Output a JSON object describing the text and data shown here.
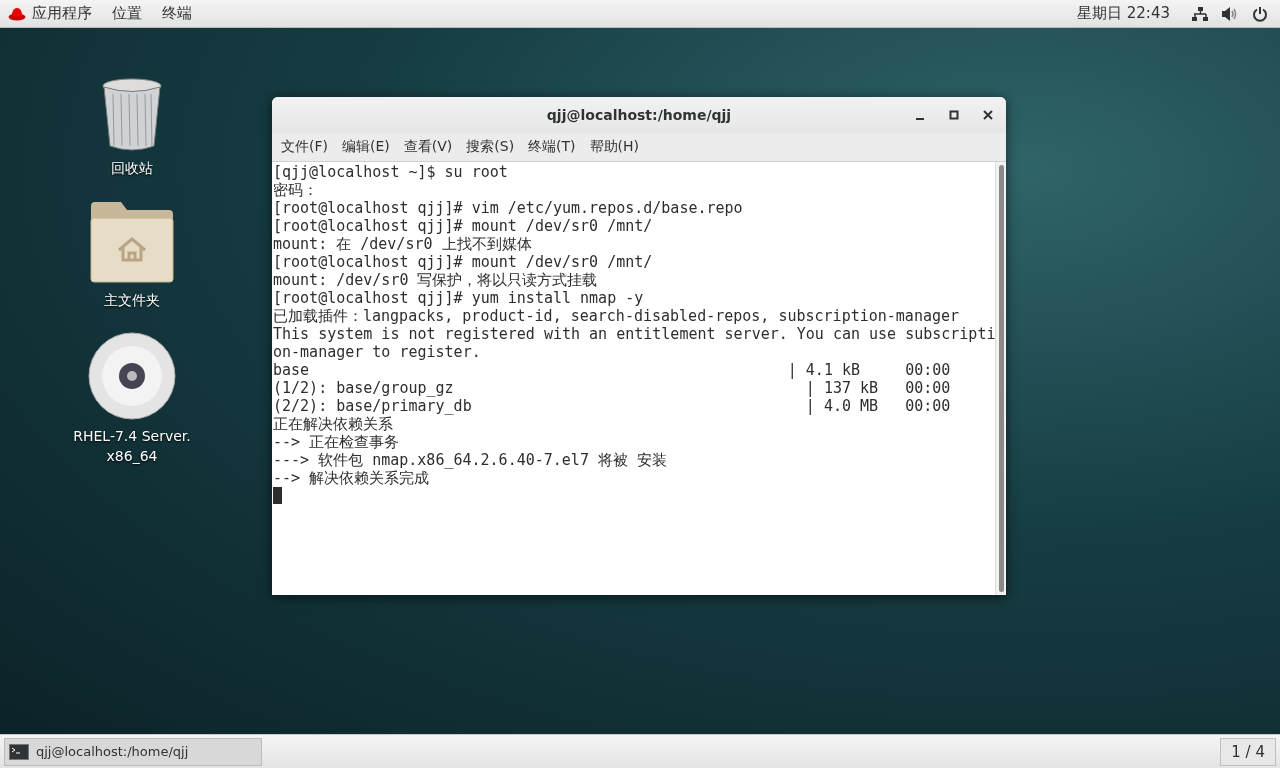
{
  "top_bar": {
    "menus": [
      "应用程序",
      "位置",
      "终端"
    ],
    "clock": "星期日 22:43"
  },
  "desktop_icons": [
    {
      "kind": "trash",
      "label": "回收站"
    },
    {
      "kind": "folder",
      "label": "主文件夹"
    },
    {
      "kind": "disc",
      "label": "RHEL-7.4 Server. x86_64"
    }
  ],
  "window": {
    "title": "qjj@localhost:/home/qjj",
    "menus": [
      "文件(F)",
      "编辑(E)",
      "查看(V)",
      "搜索(S)",
      "终端(T)",
      "帮助(H)"
    ],
    "lines": [
      "[qjj@localhost ~]$ su root",
      "密码：",
      "[root@localhost qjj]# vim /etc/yum.repos.d/base.repo",
      "[root@localhost qjj]# mount /dev/sr0 /mnt/",
      "mount: 在 /dev/sr0 上找不到媒体",
      "[root@localhost qjj]# mount /dev/sr0 /mnt/",
      "mount: /dev/sr0 写保护，将以只读方式挂载",
      "[root@localhost qjj]# yum install nmap -y",
      "已加载插件：langpacks, product-id, search-disabled-repos, subscription-manager",
      "This system is not registered with an entitlement server. You can use subscripti",
      "on-manager to register.",
      "base                                                     | 4.1 kB     00:00",
      "(1/2): base/group_gz                                       | 137 kB   00:00",
      "(2/2): base/primary_db                                     | 4.0 MB   00:00",
      "正在解决依赖关系",
      "--> 正在检查事务",
      "---> 软件包 nmap.x86_64.2.6.40-7.el7 将被 安装",
      "--> 解决依赖关系完成"
    ],
    "cursor": true
  },
  "taskbar": {
    "tasks": [
      {
        "label": "qjj@localhost:/home/qjj",
        "selected": true
      }
    ],
    "workspace": "1 / 4"
  }
}
